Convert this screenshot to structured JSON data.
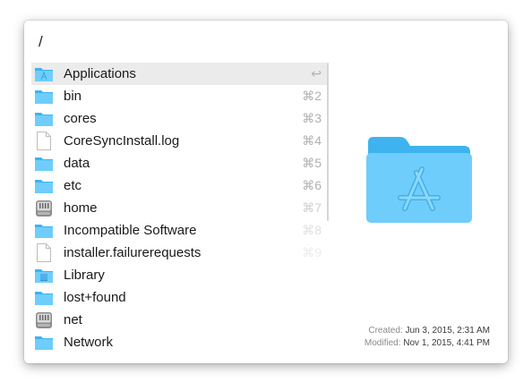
{
  "search": {
    "query": "/"
  },
  "items": [
    {
      "label": "Applications",
      "shortcut": "↩",
      "icon": "applications-folder-icon",
      "selected": true
    },
    {
      "label": "bin",
      "shortcut": "⌘2",
      "icon": "folder-icon"
    },
    {
      "label": "cores",
      "shortcut": "⌘3",
      "icon": "folder-icon"
    },
    {
      "label": "CoreSyncInstall.log",
      "shortcut": "⌘4",
      "icon": "document-icon"
    },
    {
      "label": "data",
      "shortcut": "⌘5",
      "icon": "folder-icon"
    },
    {
      "label": "etc",
      "shortcut": "⌘6",
      "icon": "folder-icon"
    },
    {
      "label": "home",
      "shortcut": "⌘7",
      "icon": "network-drive-icon"
    },
    {
      "label": "Incompatible Software",
      "shortcut": "⌘8",
      "icon": "folder-icon"
    },
    {
      "label": "installer.failurerequests",
      "shortcut": "⌘9",
      "icon": "document-icon"
    },
    {
      "label": "Library",
      "shortcut": "",
      "icon": "library-folder-icon"
    },
    {
      "label": "lost+found",
      "shortcut": "",
      "icon": "folder-icon"
    },
    {
      "label": "net",
      "shortcut": "",
      "icon": "network-drive-icon"
    },
    {
      "label": "Network",
      "shortcut": "",
      "icon": "folder-icon"
    }
  ],
  "preview": {
    "icon": "applications-folder-icon",
    "created_label": "Created:",
    "created_value": "Jun 3, 2015, 2:31 AM",
    "modified_label": "Modified:",
    "modified_value": "Nov 1, 2015, 4:41 PM"
  },
  "colors": {
    "folder_back": "#3eb3ef",
    "folder_front": "#6fcdfb",
    "selection": "#ebebeb"
  }
}
